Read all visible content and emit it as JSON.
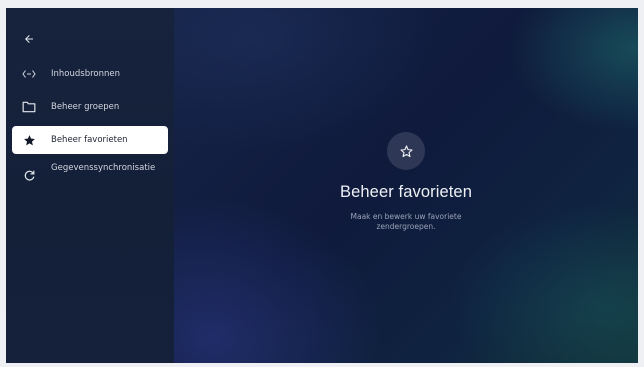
{
  "sidebar": {
    "back_icon": "arrow-left-icon",
    "items": [
      {
        "icon": "code-brackets-icon",
        "label": "Inhoudsbronnen",
        "selected": false
      },
      {
        "icon": "folder-icon",
        "label": "Beheer groepen",
        "selected": false
      },
      {
        "icon": "star-filled-icon",
        "label": "Beheer favorieten",
        "selected": true
      },
      {
        "icon": "sync-icon",
        "label": "Gegevenssynchronisatie",
        "selected": false
      }
    ]
  },
  "main": {
    "icon": "star-outline-icon",
    "title": "Beheer favorieten",
    "subtitle": "Maak en bewerk uw favoriete zendergroepen."
  },
  "colors": {
    "sidebar_bg": "#15203a",
    "selected_bg": "#ffffff",
    "text_light": "#d3d7e0",
    "text_muted": "#9aa3b8"
  }
}
